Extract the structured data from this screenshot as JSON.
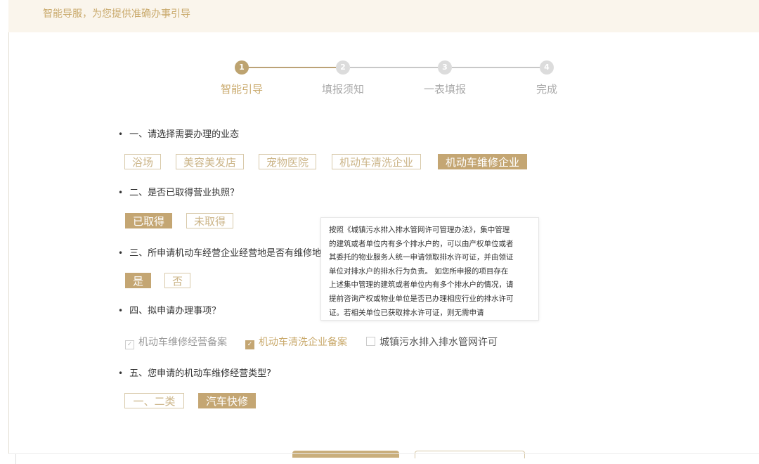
{
  "header": {
    "title": "智能导服，为您提供准确办事引导"
  },
  "stepper": {
    "steps": [
      {
        "number": "1",
        "label": "智能引导"
      },
      {
        "number": "2",
        "label": "填报须知"
      },
      {
        "number": "3",
        "label": "一表填报"
      },
      {
        "number": "4",
        "label": "完成"
      }
    ],
    "active_step": 1
  },
  "bullet": "•",
  "q1": {
    "text": "一、请选择需要办理的业态",
    "options": [
      "浴场",
      "美容美发店",
      "宠物医院",
      "机动车清洗企业",
      "机动车维修企业"
    ],
    "selected": "机动车维修企业"
  },
  "q2": {
    "text": "二、是否已取得营业执照？",
    "options": [
      "已取得",
      "未取得"
    ],
    "selected": "已取得"
  },
  "q3": {
    "text": "三、所申请机动车经营企业经营地是否有维修地",
    "options": [
      "是",
      "否"
    ],
    "selected": "是"
  },
  "q4": {
    "text": "四、拟申请办理事项？",
    "items": [
      {
        "label": "机动车维修经营备案",
        "checked": true,
        "disabled": true
      },
      {
        "label": "机动车清洗企业备案",
        "checked": true,
        "disabled": false
      },
      {
        "label": "城镇污水排入排水管网许可",
        "checked": false,
        "disabled": false
      }
    ]
  },
  "q5": {
    "text": "五、您申请的机动车维修经营类型?",
    "options": [
      "一、二类",
      "汽车快修"
    ],
    "selected": "汽车快修"
  },
  "tooltip": {
    "lines": [
      "按照《城镇污水排入排水管网许可管理办法》，集中管理",
      "的建筑或者单位内有多个排水户的，可以由产权单位或者",
      "其委托的物业服务人统一申请领取排水许可证，并由领证",
      "单位对排水户的排水行为负责。 如您所申报的项目存在",
      "上述集中管理的建筑或者单位内有多个排水户的情况，请",
      "提前咨询产权或物业单位是否已办理相应行业的排水许可",
      "证。若相关单位已获取排水许可证，则无需申请"
    ]
  },
  "colors": {
    "accent": "#c4a673",
    "header_bg": "#faf5ec",
    "inactive_step": "#dcdcdc"
  }
}
